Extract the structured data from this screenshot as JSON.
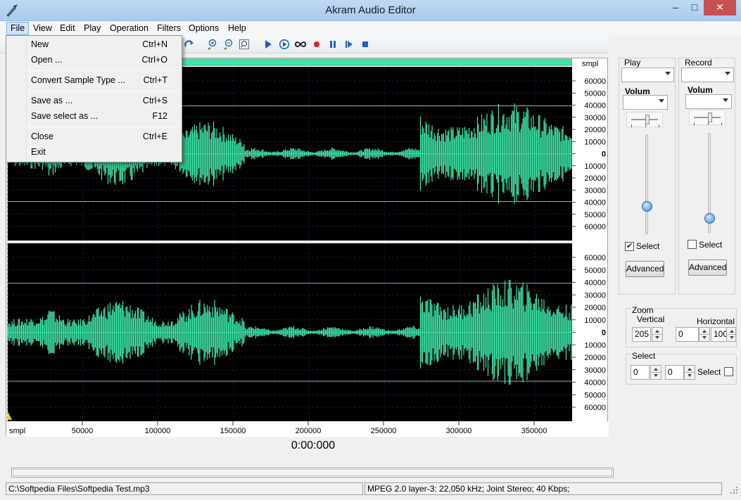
{
  "window": {
    "title": "Akram Audio Editor",
    "minimize": "–",
    "maximize": "□",
    "close": "✕"
  },
  "menubar": {
    "items": [
      {
        "label": "File"
      },
      {
        "label": "View"
      },
      {
        "label": "Edit"
      },
      {
        "label": "Play"
      },
      {
        "label": "Operation"
      },
      {
        "label": "Filters"
      },
      {
        "label": "Options"
      },
      {
        "label": "Help"
      }
    ]
  },
  "file_menu": {
    "items": [
      {
        "label": "New",
        "shortcut": "Ctrl+N"
      },
      {
        "label": "Open ...",
        "shortcut": "Ctrl+O"
      },
      {
        "label": "Convert Sample Type ...",
        "shortcut": "Ctrl+T"
      },
      {
        "label": "Save as ...",
        "shortcut": "Ctrl+S"
      },
      {
        "label": "Save select as ...",
        "shortcut": "F12"
      },
      {
        "label": "Close",
        "shortcut": "Ctrl+E"
      },
      {
        "label": "Exit",
        "shortcut": ""
      }
    ]
  },
  "toolbar": {
    "icons": [
      "redo-icon",
      "zoom-in-icon",
      "zoom-out-icon",
      "zoom-fit-icon",
      "play-icon",
      "play-loop-icon",
      "loop-icon",
      "record-icon",
      "pause-icon",
      "play-next-icon",
      "stop-icon"
    ]
  },
  "waveform": {
    "unit": "smpl",
    "y_ticks_top": [
      "60000",
      "50000",
      "40000",
      "30000",
      "20000",
      "10000",
      "0",
      "10000",
      "20000",
      "30000",
      "40000",
      "50000",
      "60000"
    ],
    "y_ticks_bottom": [
      "60000",
      "50000",
      "40000",
      "30000",
      "20000",
      "10000",
      "0",
      "10000",
      "20000",
      "30000",
      "40000",
      "50000",
      "60000"
    ],
    "x_unit": "smpl",
    "x_ticks": [
      "50000",
      "100000",
      "150000",
      "200000",
      "250000",
      "300000",
      "350000"
    ],
    "wave_color": "#3ee6a8",
    "background": "#000000"
  },
  "time_display": "0:00:000",
  "play_panel": {
    "title": "Play",
    "volume_label": "Volum",
    "select_label": "Select",
    "select_checked": true,
    "advanced_label": "Advanced",
    "volume_level": 0.25
  },
  "record_panel": {
    "title": "Record",
    "volume_label": "Volum",
    "select_label": "Select",
    "select_checked": false,
    "advanced_label": "Advanced",
    "volume_level": 0.1
  },
  "zoom": {
    "title": "Zoom",
    "vertical_label": "Vertical",
    "vertical_value": "205",
    "horizontal_label": "Horizontal",
    "horizontal_from": "0",
    "horizontal_to": "100"
  },
  "select": {
    "title": "Select",
    "from": "0",
    "to": "0",
    "select_label": "Select"
  },
  "statusbar": {
    "file": "C:\\Softpedia Files\\Softpedia Test.mp3",
    "format": "MPEG 2.0 layer-3: 22,050 kHz; Joint Stereo; 40 Kbps;"
  }
}
